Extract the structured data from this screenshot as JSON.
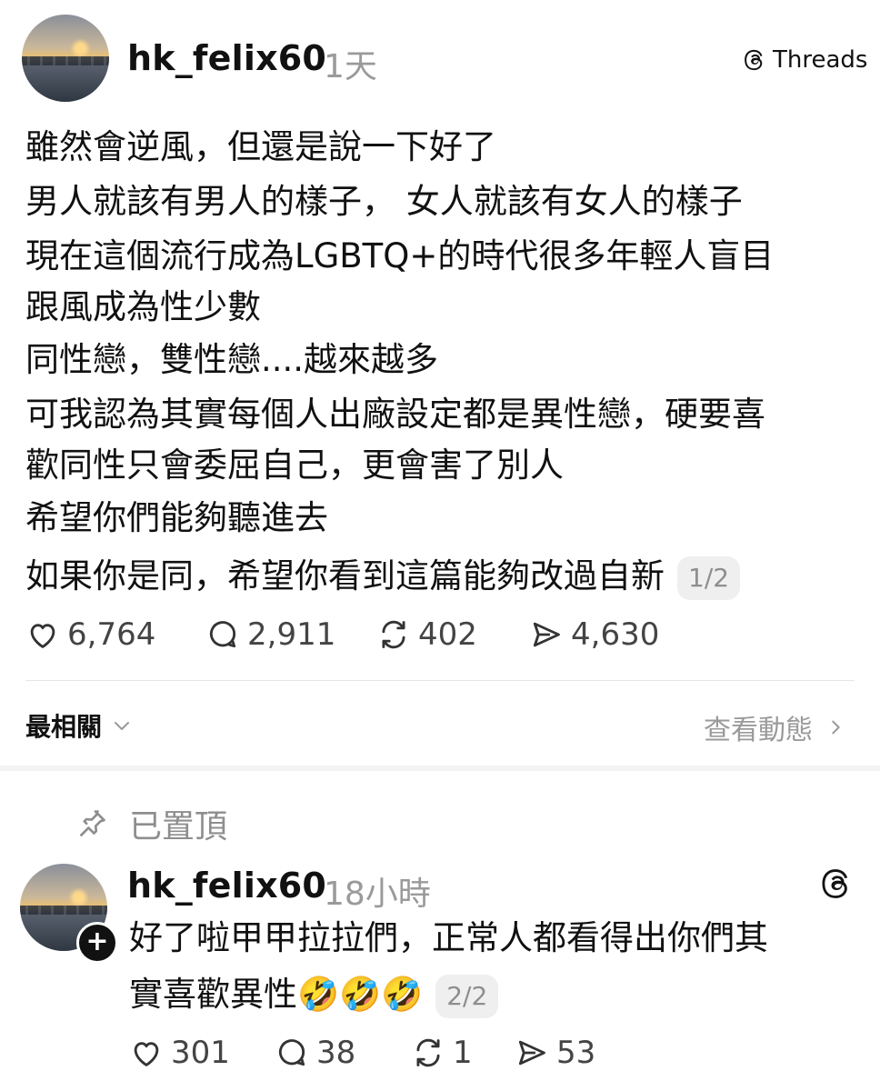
{
  "post": {
    "username": "hk_felix60",
    "time": "1天",
    "platform_label": "Threads",
    "lines": [
      "雖然會逆風，但還是說一下好了",
      "男人就該有男人的樣子，  女人就該有女人的樣子",
      "現在這個流行成為LGBTQ+的時代很多年輕人盲目",
      "跟風成為性少數",
      "同性戀，雙性戀....越來越多",
      "可我認為其實每個人出廠設定都是異性戀，硬要喜",
      "歡同性只會委屈自己，更會害了別人",
      "希望你們能夠聽進去",
      "如果你是同，希望你看到這篇能夠改過自新"
    ],
    "page_badge": "1/2",
    "stats": {
      "likes": "6,764",
      "comments": "2,911",
      "reposts": "402",
      "shares": "4,630"
    }
  },
  "replies_bar": {
    "sort_label": "最相關",
    "activity_label": "查看動態"
  },
  "reply": {
    "pinned_label": "已置頂",
    "username": "hk_felix60",
    "time": "18小時",
    "lines": [
      "好了啦甲甲拉拉們，正常人都看得出你們其",
      "實喜歡異性🤣🤣🤣"
    ],
    "page_badge": "2/2",
    "stats": {
      "likes": "301",
      "comments": "38",
      "reposts": "1",
      "shares": "53"
    }
  },
  "colors": {
    "text": "#111111",
    "muted": "#9a9a9a",
    "badge_bg": "#efefef"
  }
}
